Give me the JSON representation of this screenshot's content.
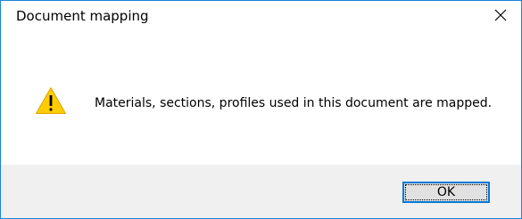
{
  "window": {
    "title": "Document mapping",
    "close_icon": "close-icon",
    "border_color": "#1883d7"
  },
  "message": {
    "icon": "warning-icon",
    "icon_color": "#ffcc00",
    "text": "Materials, sections, profiles used in this document are mapped."
  },
  "footer": {
    "ok_label": "OK",
    "background": "#f0f0f0",
    "accent": "#0078d7"
  }
}
